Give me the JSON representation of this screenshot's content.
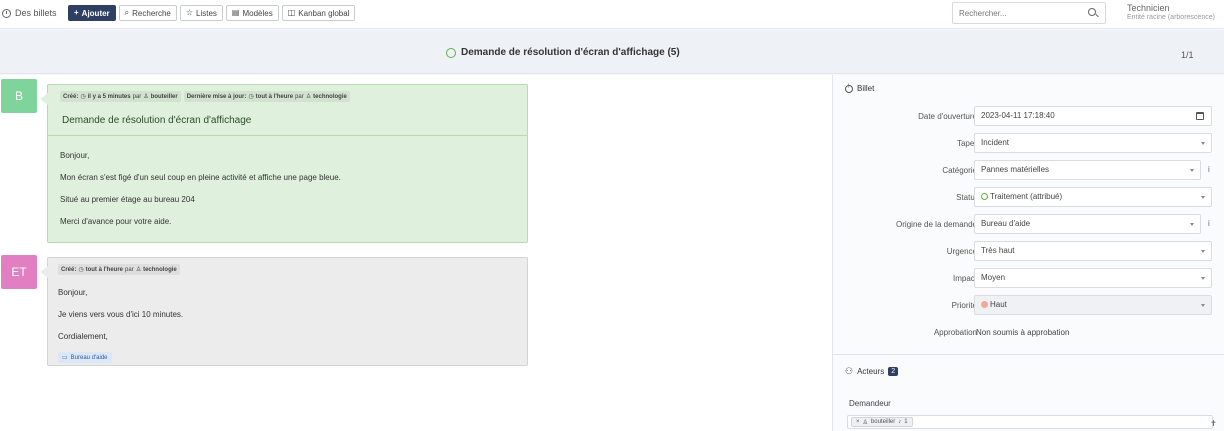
{
  "topbar": {
    "home_label": "Des billets",
    "buttons": [
      {
        "label": "Ajouter",
        "icon": "+"
      },
      {
        "label": "Recherche",
        "icon": "search-icon"
      },
      {
        "label": "Listes",
        "icon": "star-icon"
      },
      {
        "label": "Modèles",
        "icon": "list-icon"
      },
      {
        "label": "Kanban global",
        "icon": "kanban-icon"
      }
    ],
    "search_placeholder": "Rechercher...",
    "user_role": "Technicien",
    "user_entity": "Entité racine (arborescence)"
  },
  "titlebar": {
    "title": "Demande de résolution d'écran d'affichage (5)",
    "pager": "1/1",
    "status_color": "#5fb246"
  },
  "ticket": {
    "avatar_initial": "B",
    "avatar_color": "#7fd49b",
    "meta_created_label": "Créé:",
    "meta_created_time": "il y a 5 minutes",
    "meta_by": "par",
    "meta_created_user": "bouteiller",
    "meta_updated_label": "Dernière mise à jour:",
    "meta_updated_time": "tout à l'heure",
    "meta_updated_user": "technologie",
    "title": "Demande de résolution d'écran d'affichage",
    "lines": [
      "Bonjour,",
      "Mon écran s'est figé d'un seul coup en pleine activité et affiche une page bleue.",
      "Situé au premier étage au bureau 204",
      "Merci d'avance pour votre aide."
    ]
  },
  "followup": {
    "avatar_initial": "ET",
    "avatar_color": "#e17fc2",
    "meta_created_label": "Créé:",
    "meta_created_time": "tout à l'heure",
    "meta_by": "par",
    "meta_user": "technologie",
    "lines": [
      "Bonjour,",
      "Je viens vers vous d'ici 10 minutes.",
      "Cordialement,"
    ],
    "source_tag": "Bureau d'aide"
  },
  "panel": {
    "heading": "Billet",
    "fields": {
      "opening_date_label": "Date d'ouverture",
      "opening_date_value": "2023-04-11 17:18:40",
      "type_label": "Taper",
      "type_value": "Incident",
      "category_label": "Catégorie",
      "category_value": "Pannes matérielles",
      "status_label": "Statut",
      "status_value": "Traitement (attribué)",
      "origin_label": "Origine de la demande",
      "origin_value": "Bureau d'aide",
      "urgency_label": "Urgence",
      "urgency_value": "Très haut",
      "impact_label": "Impact",
      "impact_value": "Moyen",
      "priority_label": "Priorité",
      "priority_value": "Haut",
      "priority_color": "#f1a79a",
      "approval_label": "Approbation",
      "approval_value": "Non soumis à approbation"
    },
    "actors_heading": "Acteurs",
    "actors_count": "2",
    "requester_label": "Demandeur",
    "requester_name": "bouteiller",
    "requester_count": "1"
  }
}
